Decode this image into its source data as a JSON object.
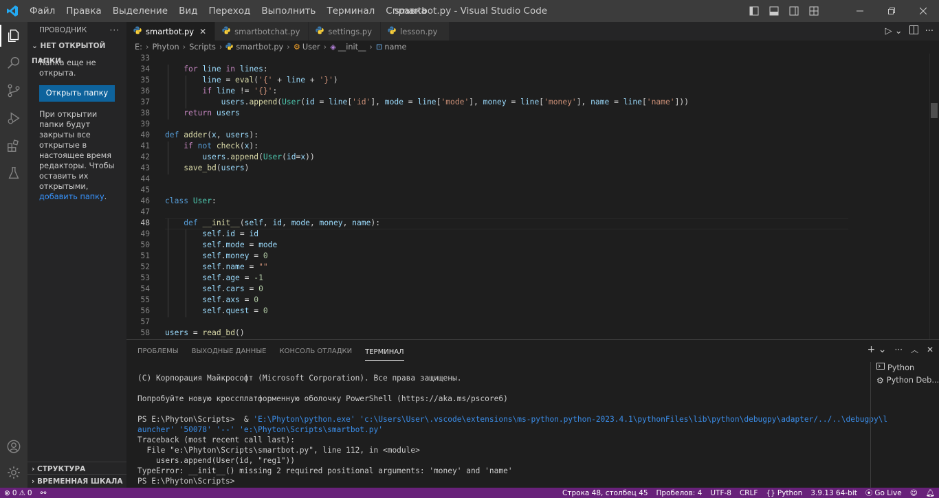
{
  "titlebar": {
    "menu": [
      "Файл",
      "Правка",
      "Выделение",
      "Вид",
      "Переход",
      "Выполнить",
      "Терминал",
      "Справка"
    ],
    "title": "smartbot.py - Visual Studio Code"
  },
  "sidebar": {
    "header": "ПРОВОДНИК",
    "section": "НЕТ ОТКРЫТОЙ ПАПКИ",
    "no_folder_text": "Папка еще не открыта.",
    "open_folder_button": "Открыть папку",
    "info_text": "При открытии папки будут закрыты все открытые в настоящее время редакторы. Чтобы оставить их открытыми,",
    "info_link": "добавить папку",
    "info_end": ".",
    "outline": "СТРУКТУРА",
    "timeline": "ВРЕМЕННАЯ ШКАЛА"
  },
  "tabs": [
    {
      "label": "smartbot.py",
      "active": true
    },
    {
      "label": "smartbotchat.py",
      "active": false
    },
    {
      "label": "settings.py",
      "active": false
    },
    {
      "label": "lesson.py",
      "active": false
    }
  ],
  "breadcrumbs": [
    "E:",
    "Phyton",
    "Scripts",
    "smartbot.py",
    "User",
    "__init__",
    "name"
  ],
  "editor": {
    "current_line": "48",
    "lines": [
      {
        "n": "33",
        "t": []
      },
      {
        "n": "34",
        "t": [
          [
            "    ",
            "p"
          ],
          [
            "for",
            "kc"
          ],
          [
            " ",
            "p"
          ],
          [
            "line",
            "v"
          ],
          [
            " ",
            "p"
          ],
          [
            "in",
            "kc"
          ],
          [
            " ",
            "p"
          ],
          [
            "lines",
            "v"
          ],
          [
            ":",
            "p"
          ]
        ]
      },
      {
        "n": "35",
        "t": [
          [
            "        ",
            "p"
          ],
          [
            "line",
            "v"
          ],
          [
            " = ",
            "p"
          ],
          [
            "eval",
            "f"
          ],
          [
            "(",
            "p"
          ],
          [
            "'{'",
            "s"
          ],
          [
            " + ",
            "p"
          ],
          [
            "line",
            "v"
          ],
          [
            " + ",
            "p"
          ],
          [
            "'}'",
            "s"
          ],
          [
            ")",
            "p"
          ]
        ]
      },
      {
        "n": "36",
        "t": [
          [
            "        ",
            "p"
          ],
          [
            "if",
            "kc"
          ],
          [
            " ",
            "p"
          ],
          [
            "line",
            "v"
          ],
          [
            " != ",
            "p"
          ],
          [
            "'{}'",
            "s"
          ],
          [
            ":",
            "p"
          ]
        ]
      },
      {
        "n": "37",
        "t": [
          [
            "            ",
            "p"
          ],
          [
            "users",
            "v"
          ],
          [
            ".",
            "p"
          ],
          [
            "append",
            "f"
          ],
          [
            "(",
            "p"
          ],
          [
            "User",
            "c"
          ],
          [
            "(",
            "p"
          ],
          [
            "id",
            "v"
          ],
          [
            " = ",
            "p"
          ],
          [
            "line",
            "v"
          ],
          [
            "[",
            "p"
          ],
          [
            "'id'",
            "s"
          ],
          [
            "], ",
            "p"
          ],
          [
            "mode",
            "v"
          ],
          [
            " = ",
            "p"
          ],
          [
            "line",
            "v"
          ],
          [
            "[",
            "p"
          ],
          [
            "'mode'",
            "s"
          ],
          [
            "], ",
            "p"
          ],
          [
            "money",
            "v"
          ],
          [
            " = ",
            "p"
          ],
          [
            "line",
            "v"
          ],
          [
            "[",
            "p"
          ],
          [
            "'money'",
            "s"
          ],
          [
            "], ",
            "p"
          ],
          [
            "name",
            "v"
          ],
          [
            " = ",
            "p"
          ],
          [
            "line",
            "v"
          ],
          [
            "[",
            "p"
          ],
          [
            "'name'",
            "s"
          ],
          [
            "]))",
            "p"
          ]
        ]
      },
      {
        "n": "38",
        "t": [
          [
            "    ",
            "p"
          ],
          [
            "return",
            "kc"
          ],
          [
            " ",
            "p"
          ],
          [
            "users",
            "v"
          ]
        ]
      },
      {
        "n": "39",
        "t": []
      },
      {
        "n": "40",
        "t": [
          [
            "def",
            "k"
          ],
          [
            " ",
            "p"
          ],
          [
            "adder",
            "f"
          ],
          [
            "(",
            "p"
          ],
          [
            "x",
            "v"
          ],
          [
            ", ",
            "p"
          ],
          [
            "users",
            "v"
          ],
          [
            "):",
            "p"
          ]
        ]
      },
      {
        "n": "41",
        "t": [
          [
            "    ",
            "p"
          ],
          [
            "if",
            "kc"
          ],
          [
            " ",
            "p"
          ],
          [
            "not",
            "k"
          ],
          [
            " ",
            "p"
          ],
          [
            "check",
            "f"
          ],
          [
            "(",
            "p"
          ],
          [
            "x",
            "v"
          ],
          [
            "):",
            "p"
          ]
        ]
      },
      {
        "n": "42",
        "t": [
          [
            "        ",
            "p"
          ],
          [
            "users",
            "v"
          ],
          [
            ".",
            "p"
          ],
          [
            "append",
            "f"
          ],
          [
            "(",
            "p"
          ],
          [
            "User",
            "c"
          ],
          [
            "(",
            "p"
          ],
          [
            "id",
            "v"
          ],
          [
            "=",
            "p"
          ],
          [
            "x",
            "v"
          ],
          [
            "))",
            "p"
          ]
        ]
      },
      {
        "n": "43",
        "t": [
          [
            "    ",
            "p"
          ],
          [
            "save_bd",
            "f"
          ],
          [
            "(",
            "p"
          ],
          [
            "users",
            "v"
          ],
          [
            ")",
            "p"
          ]
        ]
      },
      {
        "n": "44",
        "t": []
      },
      {
        "n": "45",
        "t": []
      },
      {
        "n": "46",
        "t": [
          [
            "class",
            "k"
          ],
          [
            " ",
            "p"
          ],
          [
            "User",
            "c"
          ],
          [
            ":",
            "p"
          ]
        ]
      },
      {
        "n": "47",
        "t": []
      },
      {
        "n": "48",
        "t": [
          [
            "    ",
            "p"
          ],
          [
            "def",
            "k"
          ],
          [
            " ",
            "p"
          ],
          [
            "__init__",
            "f"
          ],
          [
            "(",
            "p"
          ],
          [
            "self",
            "v"
          ],
          [
            ", ",
            "p"
          ],
          [
            "id",
            "v"
          ],
          [
            ", ",
            "p"
          ],
          [
            "mode",
            "v"
          ],
          [
            ", ",
            "p"
          ],
          [
            "money",
            "v"
          ],
          [
            ", ",
            "p"
          ],
          [
            "name",
            "v"
          ],
          [
            "):",
            "p"
          ]
        ]
      },
      {
        "n": "49",
        "t": [
          [
            "        ",
            "p"
          ],
          [
            "self",
            "v"
          ],
          [
            ".",
            "p"
          ],
          [
            "id",
            "v"
          ],
          [
            " = ",
            "p"
          ],
          [
            "id",
            "v"
          ]
        ]
      },
      {
        "n": "50",
        "t": [
          [
            "        ",
            "p"
          ],
          [
            "self",
            "v"
          ],
          [
            ".",
            "p"
          ],
          [
            "mode",
            "v"
          ],
          [
            " = ",
            "p"
          ],
          [
            "mode",
            "v"
          ]
        ]
      },
      {
        "n": "51",
        "t": [
          [
            "        ",
            "p"
          ],
          [
            "self",
            "v"
          ],
          [
            ".",
            "p"
          ],
          [
            "money",
            "v"
          ],
          [
            " = ",
            "p"
          ],
          [
            "0",
            "n"
          ]
        ]
      },
      {
        "n": "52",
        "t": [
          [
            "        ",
            "p"
          ],
          [
            "self",
            "v"
          ],
          [
            ".",
            "p"
          ],
          [
            "name",
            "v"
          ],
          [
            " = ",
            "p"
          ],
          [
            "\"\"",
            "s"
          ]
        ]
      },
      {
        "n": "53",
        "t": [
          [
            "        ",
            "p"
          ],
          [
            "self",
            "v"
          ],
          [
            ".",
            "p"
          ],
          [
            "age",
            "v"
          ],
          [
            " = ",
            "p"
          ],
          [
            "-1",
            "n"
          ]
        ]
      },
      {
        "n": "54",
        "t": [
          [
            "        ",
            "p"
          ],
          [
            "self",
            "v"
          ],
          [
            ".",
            "p"
          ],
          [
            "cars",
            "v"
          ],
          [
            " = ",
            "p"
          ],
          [
            "0",
            "n"
          ]
        ]
      },
      {
        "n": "55",
        "t": [
          [
            "        ",
            "p"
          ],
          [
            "self",
            "v"
          ],
          [
            ".",
            "p"
          ],
          [
            "axs",
            "v"
          ],
          [
            " = ",
            "p"
          ],
          [
            "0",
            "n"
          ]
        ]
      },
      {
        "n": "56",
        "t": [
          [
            "        ",
            "p"
          ],
          [
            "self",
            "v"
          ],
          [
            ".",
            "p"
          ],
          [
            "quest",
            "v"
          ],
          [
            " = ",
            "p"
          ],
          [
            "0",
            "n"
          ]
        ]
      },
      {
        "n": "57",
        "t": []
      },
      {
        "n": "58",
        "t": [
          [
            "users",
            "v"
          ],
          [
            " = ",
            "p"
          ],
          [
            "read_bd",
            "f"
          ],
          [
            "()",
            "p"
          ]
        ]
      }
    ]
  },
  "panel": {
    "tabs": [
      "ПРОБЛЕМЫ",
      "ВЫХОДНЫЕ ДАННЫЕ",
      "КОНСОЛЬ ОТЛАДКИ",
      "ТЕРМИНАЛ"
    ],
    "active_tab": "ТЕРМИНАЛ",
    "terminal_lines": [
      [
        [
          "(C) Корпорация Майкрософт (Microsoft Corporation). Все права защищены.",
          "tcmd"
        ]
      ],
      [
        [
          "",
          "tcmd"
        ]
      ],
      [
        [
          "Попробуйте новую кроссплатформенную оболочку PowerShell (https://aka.ms/pscore6)",
          "tcmd"
        ]
      ],
      [
        [
          "",
          "tcmd"
        ]
      ],
      [
        [
          "PS E:\\Phyton\\Scripts>  & ",
          "tcmd"
        ],
        [
          "'E:\\Phyton\\python.exe' 'c:\\Users\\User\\.vscode\\extensions\\ms-python.python-2023.4.1\\pythonFiles\\lib\\python\\debugpy\\adapter/../..\\debugpy\\l",
          "tstr"
        ]
      ],
      [
        [
          "auncher' '50078' '--' 'e:\\Phyton\\Scripts\\smartbot.py'",
          "tstr"
        ]
      ],
      [
        [
          "Traceback (most recent call last):",
          "tcmd"
        ]
      ],
      [
        [
          "  File \"e:\\Phyton\\Scripts\\smartbot.py\", line 112, in <module>",
          "tcmd"
        ]
      ],
      [
        [
          "    users.append(User(id, \"reg1\"))",
          "tcmd"
        ]
      ],
      [
        [
          "TypeError: __init__() missing 2 required positional arguments: 'money' and 'name'",
          "tcmd"
        ]
      ],
      [
        [
          "PS E:\\Phyton\\Scripts> ",
          "tcmd"
        ]
      ]
    ],
    "terminal_list": [
      "Python",
      "Python Deb..."
    ]
  },
  "statusbar": {
    "errors": "0",
    "warnings": "0",
    "position": "Строка 48, столбец 45",
    "spaces": "Пробелов: 4",
    "encoding": "UTF-8",
    "eol": "CRLF",
    "language": "Python",
    "interpreter": "3.9.13 64-bit",
    "golive": "Go Live"
  },
  "colors": {
    "statusbar": "#68217a",
    "accent": "#0e639c",
    "titlebar": "#3c3c3c"
  }
}
